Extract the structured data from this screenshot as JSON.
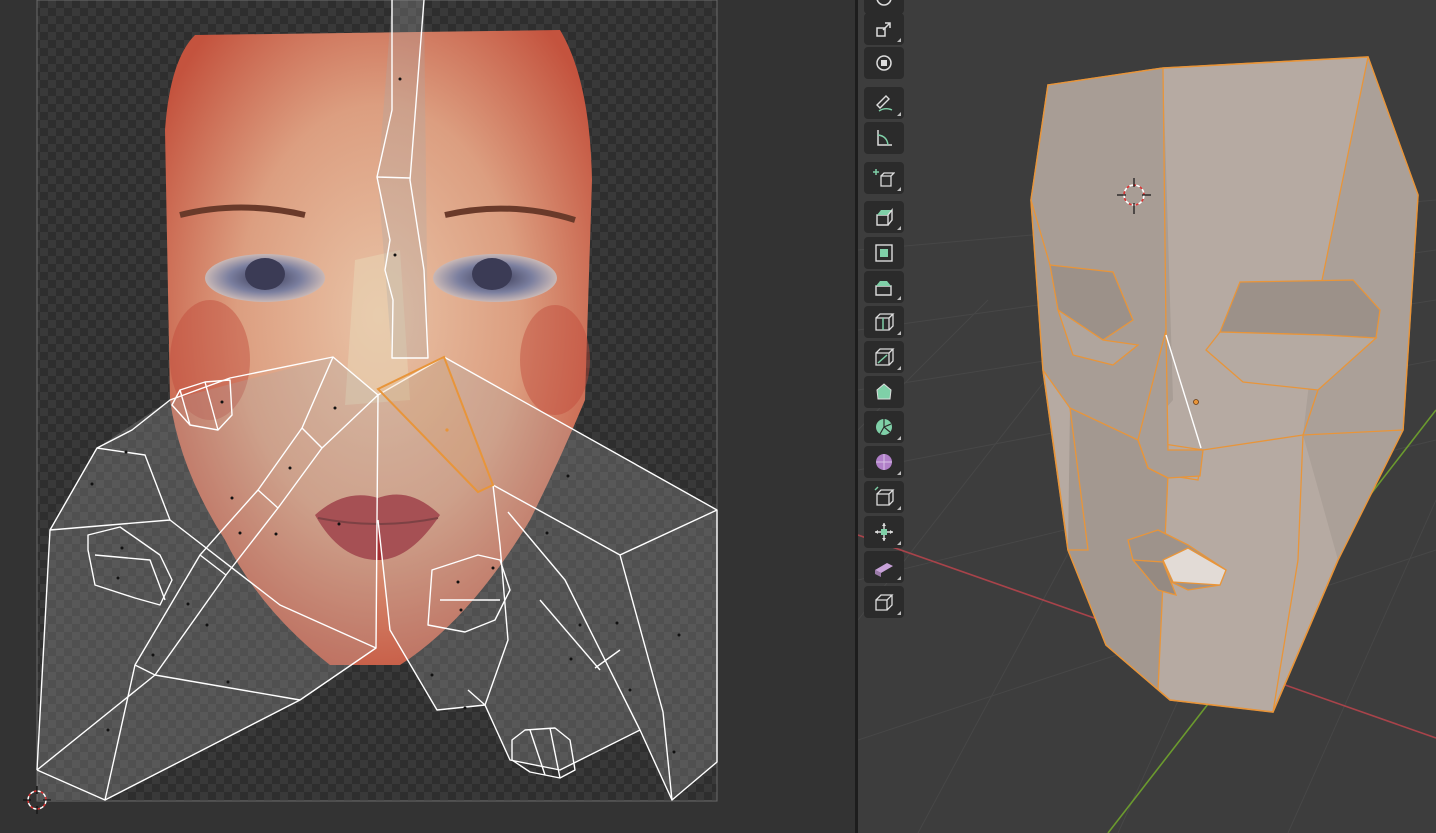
{
  "uv_editor": {
    "name": "uv-editor"
  },
  "viewport": {
    "name": "3d-viewport"
  },
  "toolbar": {
    "tools": [
      {
        "id": "rotate",
        "icon": "rotate-icon"
      },
      {
        "id": "scale",
        "icon": "scale-icon"
      },
      {
        "id": "transform",
        "icon": "transform-icon"
      },
      {
        "id": "annotate",
        "icon": "annotate-icon"
      },
      {
        "id": "measure",
        "icon": "measure-icon"
      },
      {
        "id": "add-cube",
        "icon": "add-cube-icon"
      },
      {
        "id": "extrude-region",
        "icon": "extrude-region-icon"
      },
      {
        "id": "inset-faces",
        "icon": "inset-faces-icon"
      },
      {
        "id": "bevel",
        "icon": "bevel-icon"
      },
      {
        "id": "loop-cut",
        "icon": "loop-cut-icon"
      },
      {
        "id": "knife",
        "icon": "knife-icon"
      },
      {
        "id": "poly-build",
        "icon": "poly-build-icon"
      },
      {
        "id": "spin",
        "icon": "spin-icon"
      },
      {
        "id": "smooth",
        "icon": "smooth-icon"
      },
      {
        "id": "edge-slide",
        "icon": "edge-slide-icon"
      },
      {
        "id": "shrink-fatten",
        "icon": "shrink-fatten-icon"
      },
      {
        "id": "shear",
        "icon": "shear-icon"
      },
      {
        "id": "rip-region",
        "icon": "rip-region-icon"
      }
    ]
  },
  "colors": {
    "selection": "#e8953a",
    "axis_x": "#a8434a",
    "axis_y": "#6b9a2e",
    "mesh_face": "#b6aaa2",
    "uv_edge": "#ffffff"
  }
}
